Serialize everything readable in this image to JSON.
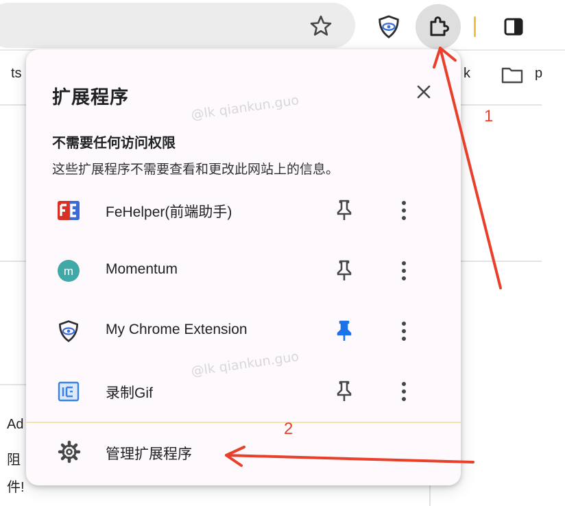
{
  "toolbar": {
    "icons": [
      "star-icon",
      "shield-extension-icon",
      "puzzle-extensions-icon",
      "side-panel-icon"
    ]
  },
  "bookmarks": {
    "left_fragment": "ts",
    "right_fragment": "k",
    "folder_fragment": "p"
  },
  "background": {
    "line1": "Ad",
    "line2": "阻",
    "line3": "件!"
  },
  "popup": {
    "title": "扩展程序",
    "section_title": "不需要任何访问权限",
    "section_desc": "这些扩展程序不需要查看和更改此网站上的信息。",
    "watermark": "@lk qiankun.guo",
    "extensions": [
      {
        "name": "FeHelper(前端助手)",
        "icon": "fehelper-icon",
        "pinned": false
      },
      {
        "name": "Momentum",
        "icon": "momentum-icon",
        "pinned": false
      },
      {
        "name": "My Chrome Extension",
        "icon": "shield-extension-icon",
        "pinned": true
      },
      {
        "name": "录制Gif",
        "icon": "record-gif-icon",
        "pinned": false
      }
    ],
    "manage_label": "管理扩展程序"
  },
  "annotations": {
    "label1": "1",
    "label2": "2",
    "color": "#e8402a"
  },
  "colors": {
    "pin_active": "#1a73e8",
    "pin_inactive": "#444746",
    "accent_divider": "#f1c232"
  }
}
